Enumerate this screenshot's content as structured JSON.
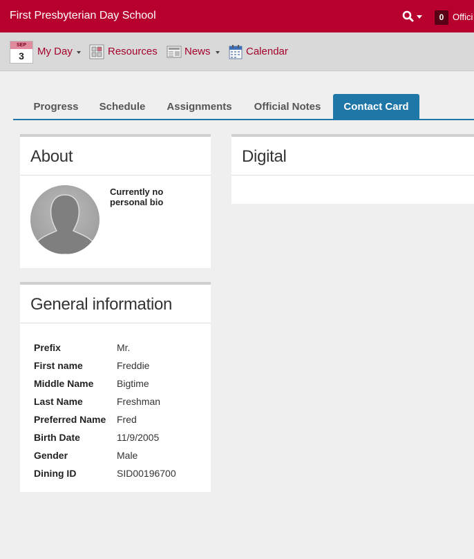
{
  "header": {
    "school_name": "First Presbyterian Day School",
    "badge_count": "0",
    "right_label": "Offici"
  },
  "nav": {
    "calendar_month": "SEP",
    "calendar_day": "3",
    "items": [
      {
        "label": "My Day",
        "icon": "calendar-day-icon",
        "has_dropdown": true
      },
      {
        "label": "Resources",
        "icon": "resources-icon",
        "has_dropdown": false
      },
      {
        "label": "News",
        "icon": "news-icon",
        "has_dropdown": true
      },
      {
        "label": "Calendar",
        "icon": "calendar-icon",
        "has_dropdown": false
      }
    ]
  },
  "tabs": [
    {
      "label": "Progress",
      "active": false
    },
    {
      "label": "Schedule",
      "active": false
    },
    {
      "label": "Assignments",
      "active": false
    },
    {
      "label": "Official Notes",
      "active": false
    },
    {
      "label": "Contact Card",
      "active": true
    }
  ],
  "about": {
    "title": "About",
    "bio": "Currently no personal bio"
  },
  "general": {
    "title": "General information",
    "rows": [
      {
        "label": "Prefix",
        "value": "Mr."
      },
      {
        "label": "First name",
        "value": "Freddie"
      },
      {
        "label": "Middle Name",
        "value": "Bigtime"
      },
      {
        "label": "Last Name",
        "value": "Freshman"
      },
      {
        "label": "Preferred Name",
        "value": "Fred"
      },
      {
        "label": "Birth Date",
        "value": "11/9/2005"
      },
      {
        "label": "Gender",
        "value": "Male"
      },
      {
        "label": "Dining ID",
        "value": "SID00196700"
      }
    ]
  },
  "digital": {
    "title": "Digital"
  },
  "colors": {
    "brand": "#b8002e",
    "tab_active": "#1f77a8",
    "link": "#a3002a"
  }
}
